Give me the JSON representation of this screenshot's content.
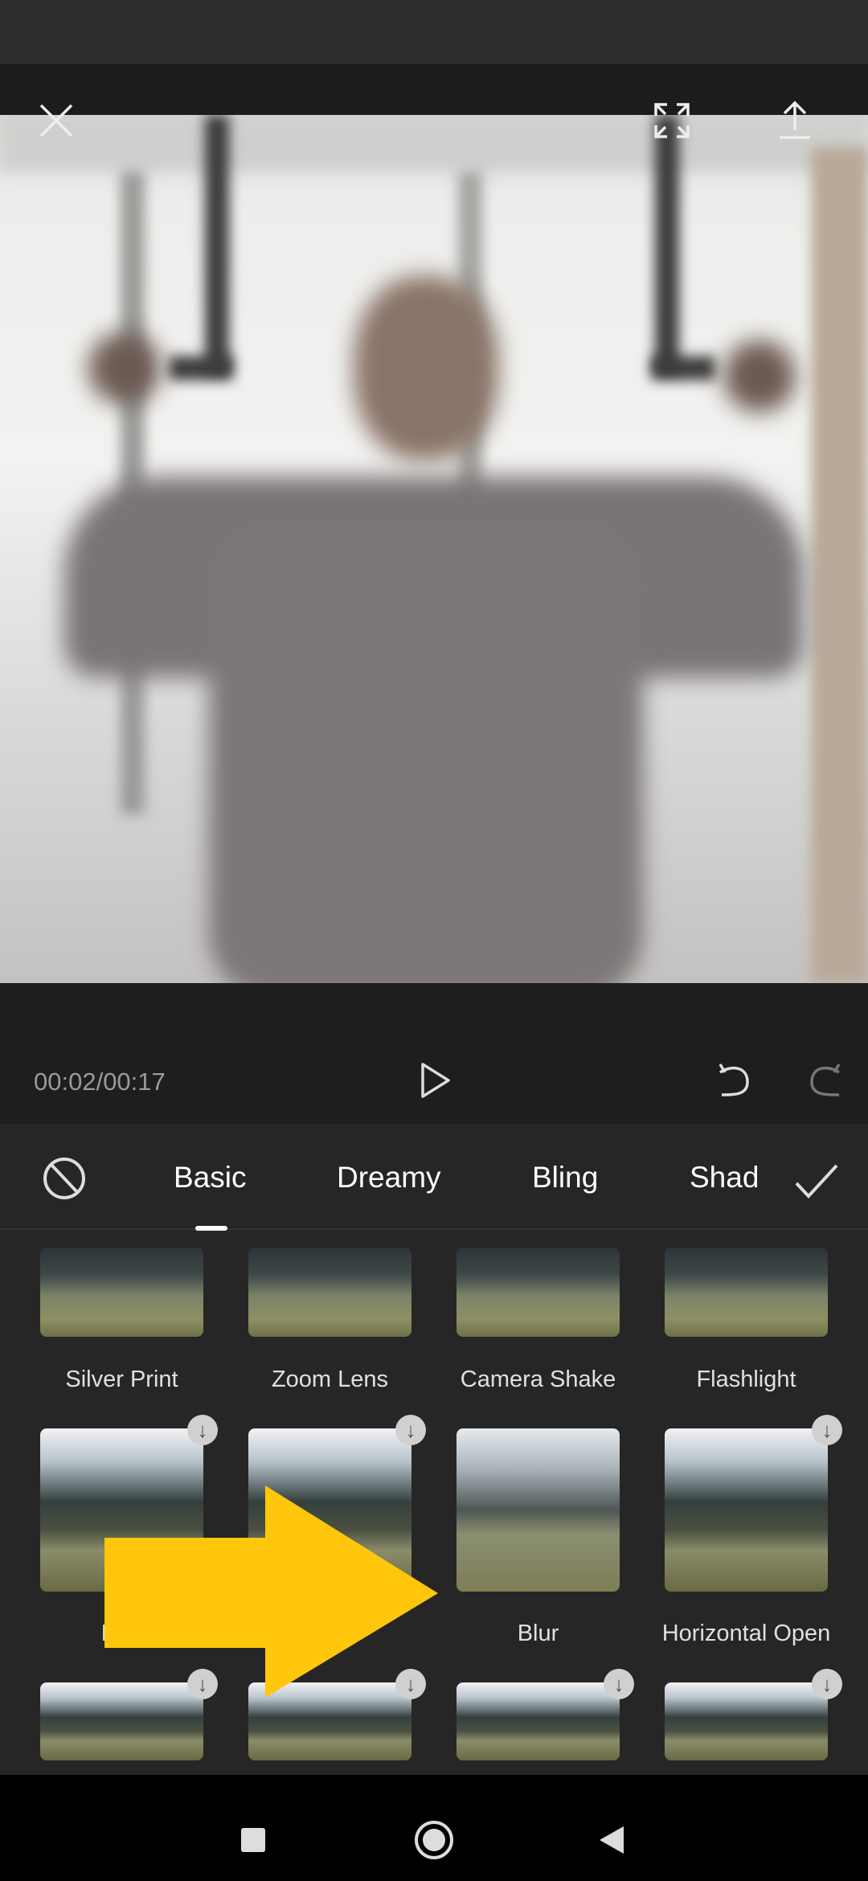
{
  "player": {
    "time": "00:02/00:17"
  },
  "tabs": [
    {
      "label": "Basic",
      "active": true
    },
    {
      "label": "Dreamy"
    },
    {
      "label": "Bling"
    },
    {
      "label": "Shad"
    }
  ],
  "effects": [
    {
      "label": "Silver Print",
      "download": false
    },
    {
      "label": "Zoom Lens",
      "download": false
    },
    {
      "label": "Camera Shake",
      "download": false
    },
    {
      "label": "Flashlight",
      "download": false
    },
    {
      "label": "Edg",
      "download": true
    },
    {
      "label": "",
      "download": true
    },
    {
      "label": "Blur",
      "download": false
    },
    {
      "label": "Horizontal Open",
      "download": true
    },
    {
      "label": "",
      "download": true
    },
    {
      "label": "",
      "download": true
    },
    {
      "label": "",
      "download": true
    },
    {
      "label": "",
      "download": true
    }
  ],
  "annotation": {
    "arrow_color": "#FFC60B"
  },
  "colors": {
    "background": "#262626",
    "accent": "#ffffff"
  }
}
